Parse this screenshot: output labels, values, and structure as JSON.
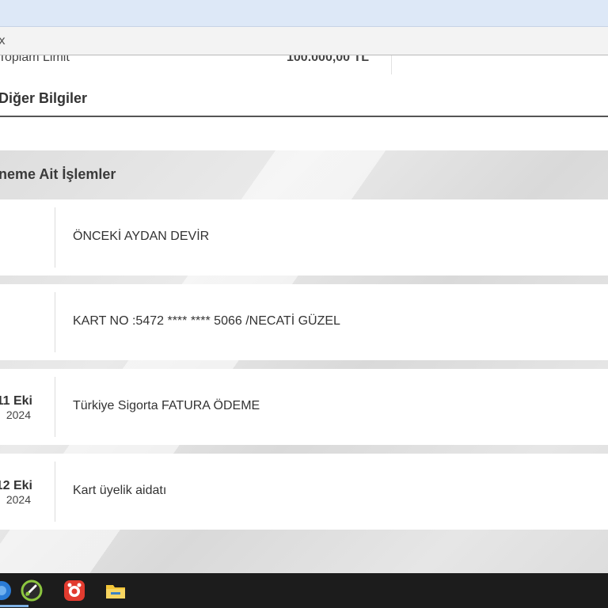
{
  "browser": {
    "tab_close_glyph": "x"
  },
  "summary": {
    "limit_label": "Toplam Limit",
    "limit_value": "100.000,00 TL",
    "other_info": "Diğer Bilgiler"
  },
  "transactions": {
    "title": "neme Ait İşlemler",
    "items": [
      {
        "day": "",
        "year": "",
        "description": "ÖNCEKİ AYDAN DEVİR"
      },
      {
        "day": "",
        "year": "",
        "description": "KART NO :5472 **** **** 5066 /NECATİ GÜZEL"
      },
      {
        "day": "11 Eki",
        "year": "2024",
        "description": "Türkiye Sigorta FATURA ÖDEME"
      },
      {
        "day": "12 Eki",
        "year": "2024",
        "description": "Kart üyelik aidatı"
      }
    ]
  },
  "taskbar": {
    "icons": [
      "browser-icon",
      "recorder-icon",
      "camera-app-icon",
      "file-explorer-icon"
    ],
    "colors": {
      "recorder_red": "#e23b2f",
      "explorer_yellow": "#f2c537"
    }
  }
}
